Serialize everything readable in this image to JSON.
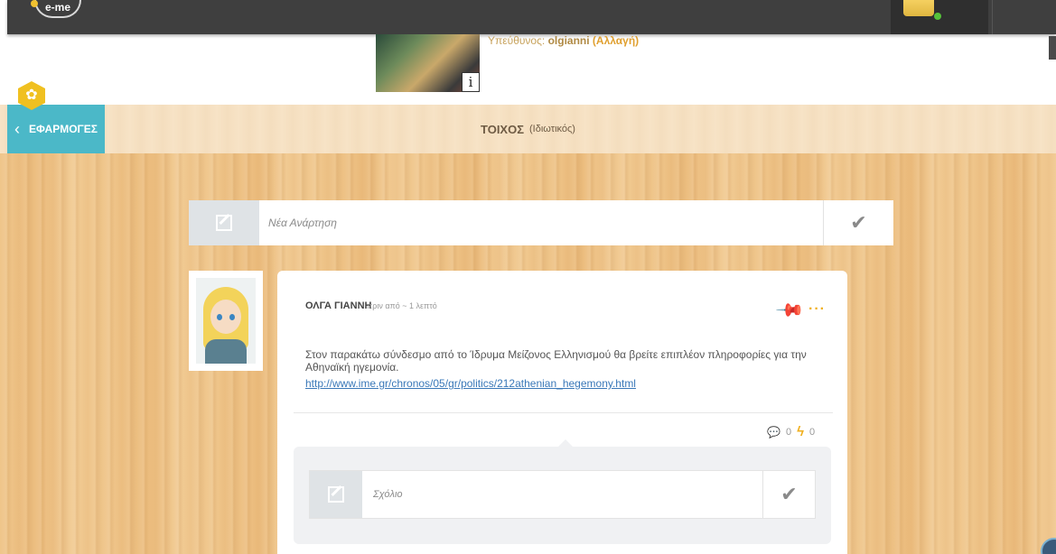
{
  "topbar": {
    "logo_text": "e-me",
    "colors": {
      "bar": "#3f3f3f",
      "online": "#55c23a"
    }
  },
  "header": {
    "owner_prefix": "Υπεύθυνος:",
    "owner_name": "olgianni",
    "owner_change": "(Αλλαγή)",
    "info_label": "i"
  },
  "nav": {
    "apps_label": "ΕΦΑΡΜΟΓΕΣ",
    "back_icon": "chevron-left-icon",
    "settings_icon": "gear-icon"
  },
  "page": {
    "title": "ΤΟΙΧΟΣ",
    "subtitle": "(Ιδιωτικός)"
  },
  "new_post": {
    "placeholder": "Νέα Ανάρτηση",
    "submit_icon": "checkmark-icon"
  },
  "post": {
    "author": "ΟΛΓΑ ΓΙΑΝΝΗ",
    "time": "πριν από ~ 1 λεπτό",
    "text": "Στον παρακάτω σύνδεσμο από το Ίδρυμα Μείζονος Ελληνισμού θα βρείτε επιπλέον πληροφορίες για την Αθηναϊκή ηγεμονία.",
    "link": "http://www.ime.gr/chronos/05/gr/politics/212athenian_hegemony.html",
    "comments_count": "0",
    "likes_count": "0",
    "icons": {
      "pin": "pin-icon",
      "more": "more-icon",
      "comments": "comment-icon",
      "likes": "bolt-icon"
    }
  },
  "comment": {
    "placeholder": "Σχόλιο"
  },
  "colors": {
    "accent_teal": "#4bb8c8",
    "accent_yellow": "#f0c020",
    "link": "#3a78b8"
  }
}
